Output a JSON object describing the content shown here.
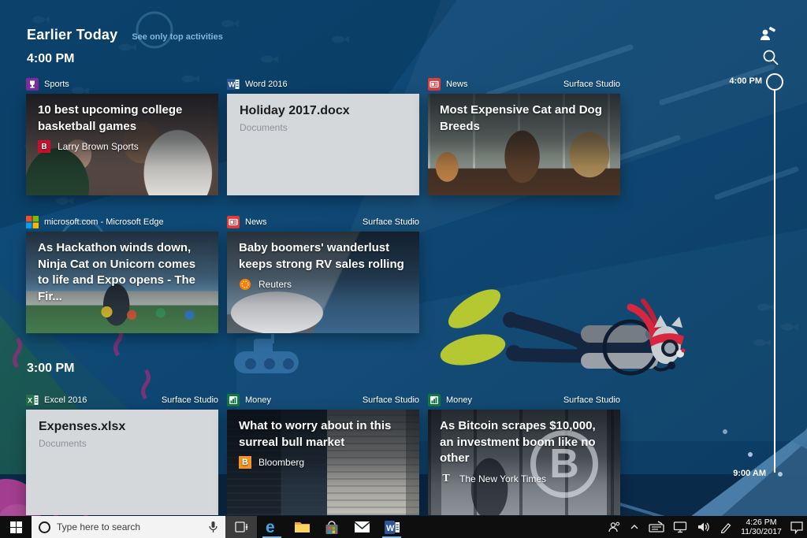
{
  "header": {
    "title": "Earlier Today",
    "filter_link": "See only top activities"
  },
  "groups": {
    "four_pm": {
      "label": "4:00 PM"
    },
    "three_pm": {
      "label": "3:00 PM"
    }
  },
  "rail": {
    "start_label": "4:00 PM",
    "end_label": "9:00 AM"
  },
  "cards": {
    "sports": {
      "app": "Sports",
      "title": "10 best upcoming college basketball games",
      "source": "Larry Brown Sports",
      "source_logo_glyph": "B"
    },
    "word": {
      "app": "Word 2016",
      "title": "Holiday 2017.docx",
      "subtitle": "Documents"
    },
    "news_pets": {
      "app": "News",
      "device": "Surface Studio",
      "title": "Most Expensive Cat and Dog Breeds"
    },
    "edge": {
      "app": "microsoft.com - Microsoft Edge",
      "title": "As Hackathon winds down, Ninja Cat on Unicorn comes to life and Expo opens - The Fir..."
    },
    "news_rv": {
      "app": "News",
      "device": "Surface Studio",
      "title": "Baby boomers' wanderlust keeps strong RV sales rolling",
      "source": "Reuters"
    },
    "excel": {
      "app": "Excel 2016",
      "device": "Surface Studio",
      "title": "Expenses.xlsx",
      "subtitle": "Documents"
    },
    "money_bull": {
      "app": "Money",
      "device": "Surface Studio",
      "title": "What to worry about in this surreal bull market",
      "source": "Bloomberg",
      "source_logo_glyph": "B"
    },
    "money_btc": {
      "app": "Money",
      "device": "Surface Studio",
      "title": "As Bitcoin scrapes $10,000, an investment boom like no other",
      "source": "The New York Times",
      "source_logo_glyph": "T",
      "watermark_glyph": "B"
    }
  },
  "taskbar": {
    "search_placeholder": "Type here to search",
    "clock": {
      "time": "4:26 PM",
      "date": "11/30/2017"
    }
  },
  "icons": {
    "user-annotation": "person-with-pencil",
    "search": "magnifier",
    "start": "windows-logo",
    "cortana": "ring",
    "microphone": "mic",
    "task-view": "timeline-panel",
    "edge": "letter-e",
    "file-explorer": "folder",
    "store": "shopping-bag",
    "mail": "envelope",
    "word": "letter-w-tile",
    "people": "person",
    "hidden-icons": "chevron-up",
    "touch-keyboard": "keyboard-pen",
    "network": "monitor",
    "volume": "speaker",
    "windows-ink": "pen",
    "action-center": "speech-bubble"
  },
  "colors": {
    "accent": "#0078d7",
    "link": "#7cb9dd",
    "news_red": "#e13b3d",
    "sports_purple": "#7b2d9b",
    "word_blue": "#2b579a",
    "excel_green": "#217346",
    "money_green": "#0e7a41",
    "ms_red": "#f25022",
    "ms_green": "#7fba00",
    "ms_blue": "#00a4ef",
    "ms_yellow": "#ffb900",
    "bloomberg_orange": "#f7941e",
    "reuters_orange": "#ff8000",
    "run_indicator": "#76b9ed"
  }
}
